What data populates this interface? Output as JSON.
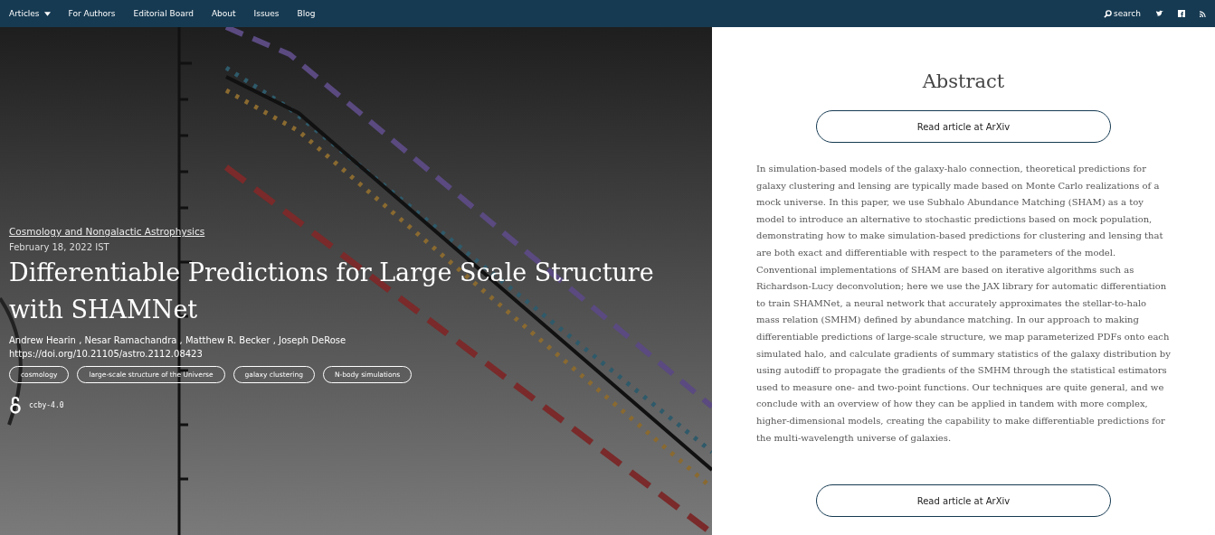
{
  "nav": {
    "items": [
      {
        "label": "Articles",
        "dropdown": true
      },
      {
        "label": "For Authors",
        "dropdown": false
      },
      {
        "label": "Editorial Board",
        "dropdown": false
      },
      {
        "label": "About",
        "dropdown": false
      },
      {
        "label": "Issues",
        "dropdown": false
      },
      {
        "label": "Blog",
        "dropdown": false
      }
    ],
    "search": "search"
  },
  "hero": {
    "category": "Cosmology and Nongalactic Astrophysics",
    "date": "February 18, 2022 IST",
    "title": "Differentiable Predictions for Large Scale Structure with SHAMNet",
    "authors": "Andrew Hearin , Nesar Ramachandra , Matthew R. Becker , Joseph DeRose",
    "doi": "https://doi.org/10.21105/astro.2112.08423",
    "tags": [
      "cosmology",
      "large-scale structure of the Universe",
      "galaxy clustering",
      "N-body simulations"
    ],
    "license": "ccby-4.0"
  },
  "abstract": {
    "heading": "Abstract",
    "button_top": "Read article at ArXiv",
    "text": "In simulation-based models of the galaxy-halo connection, theoretical predictions for galaxy clustering and lensing are typically made based on Monte Carlo realizations of a mock universe. In this paper, we use Subhalo Abundance Matching (SHAM) as a toy model to introduce an alternative to stochastic predictions based on mock population, demonstrating how to make simulation-based predictions for clustering and lensing that are both exact and differentiable with respect to the parameters of the model. Conventional implementations of SHAM are based on iterative algorithms such as Richardson-Lucy deconvolution; here we use the JAX library for automatic differentiation to train SHAMNet, a neural network that accurately approximates the stellar-to-halo mass relation (SMHM) defined by abundance matching. In our approach to making differentiable predictions of large-scale structure, we map parameterized PDFs onto each simulated halo, and calculate gradients of summary statistics of the galaxy distribution by using autodiff to propagate the gradients of the SMHM through the statistical estimators used to measure one- and two-point functions. Our techniques are quite general, and we conclude with an overview of how they can be applied in tandem with more complex, higher-dimensional models, creating the capability to make differentiable predictions for the multi-wavelength universe of galaxies.",
    "button_bottom": "Read article at ArXiv"
  }
}
